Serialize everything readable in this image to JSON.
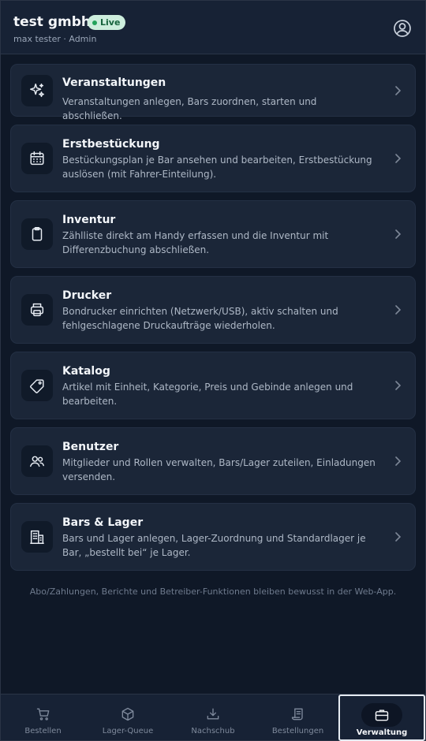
{
  "header": {
    "org_name": "test gmbh",
    "status_badge": "Live",
    "user_line": "max tester · Admin",
    "account_icon": "account-circle-icon"
  },
  "menu": {
    "items": [
      {
        "title": "Veranstaltungen",
        "description": "Veranstaltungen anlegen, Bars zuordnen, starten und abschließen.",
        "icon": "sparkles-icon"
      },
      {
        "title": "Erstbestückung",
        "description": "Bestückungsplan je Bar ansehen und bearbeiten, Erstbestückung auslösen (mit Fahrer-Einteilung).",
        "icon": "calendar-icon"
      },
      {
        "title": "Inventur",
        "description": "Zählliste direkt am Handy erfassen und die Inventur mit Differenzbuchung abschließen.",
        "icon": "clipboard-icon"
      },
      {
        "title": "Drucker",
        "description": "Bondrucker einrichten (Netzwerk/USB), aktiv schalten und fehlgeschlagene Druckaufträge wiederholen.",
        "icon": "printer-icon"
      },
      {
        "title": "Katalog",
        "description": "Artikel mit Einheit, Kategorie, Preis und Gebinde anlegen und bearbeiten.",
        "icon": "tag-icon"
      },
      {
        "title": "Benutzer",
        "description": "Mitglieder und Rollen verwalten, Bars/Lager zuteilen, Einladungen versenden.",
        "icon": "users-icon"
      },
      {
        "title": "Bars & Lager",
        "description": "Bars und Lager anlegen, Lager-Zuordnung und Standardlager je Bar, „bestellt bei“ je Lager.",
        "icon": "building-icon"
      }
    ]
  },
  "footer_note": "Abo/Zahlungen, Berichte und Betreiber-Funktionen bleiben bewusst in der Web-App.",
  "tabs": [
    {
      "label": "Bestellen",
      "icon": "cart-icon",
      "active": false
    },
    {
      "label": "Lager-Queue",
      "icon": "box-icon",
      "active": false
    },
    {
      "label": "Nachschub",
      "icon": "download-icon",
      "active": false
    },
    {
      "label": "Bestellungen",
      "icon": "receipt-icon",
      "active": false
    },
    {
      "label": "Verwaltung",
      "icon": "briefcase-icon",
      "active": true
    }
  ],
  "colors": {
    "background": "#0f1827",
    "card": "#1b2638",
    "badge_bg": "#cdeedd",
    "badge_text": "#17643d"
  }
}
